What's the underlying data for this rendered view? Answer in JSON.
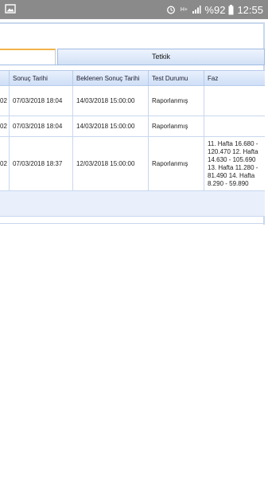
{
  "status_bar": {
    "net": "H+",
    "battery_pct": "%92",
    "time": "12:55"
  },
  "tabs": [
    {
      "label": ""
    },
    {
      "label": "Tetkik"
    }
  ],
  "table": {
    "headers": [
      "Sonuç Tarihi",
      "Beklenen Sonuç Tarihi",
      "Test Durumu",
      "Faz"
    ],
    "rows": [
      {
        "lead": "02",
        "sonuc": "07/03/2018 18:04",
        "beklenen": "14/03/2018 15:00:00",
        "durum": "Raporlanmış",
        "faz": ""
      },
      {
        "lead": "02",
        "sonuc": "07/03/2018 18:04",
        "beklenen": "14/03/2018 15:00:00",
        "durum": "Raporlanmış",
        "faz": ""
      },
      {
        "lead": "02",
        "sonuc": "07/03/2018 18:37",
        "beklenen": "12/03/2018 15:00:00",
        "durum": "Raporlanmış",
        "faz": "11. Hafta 16.680 - 120.470 12. Hafta 14.630 - 105.690 13. Hafta 11.280 - 81.490 14. Hafta 8.290 - 59.890"
      }
    ]
  }
}
